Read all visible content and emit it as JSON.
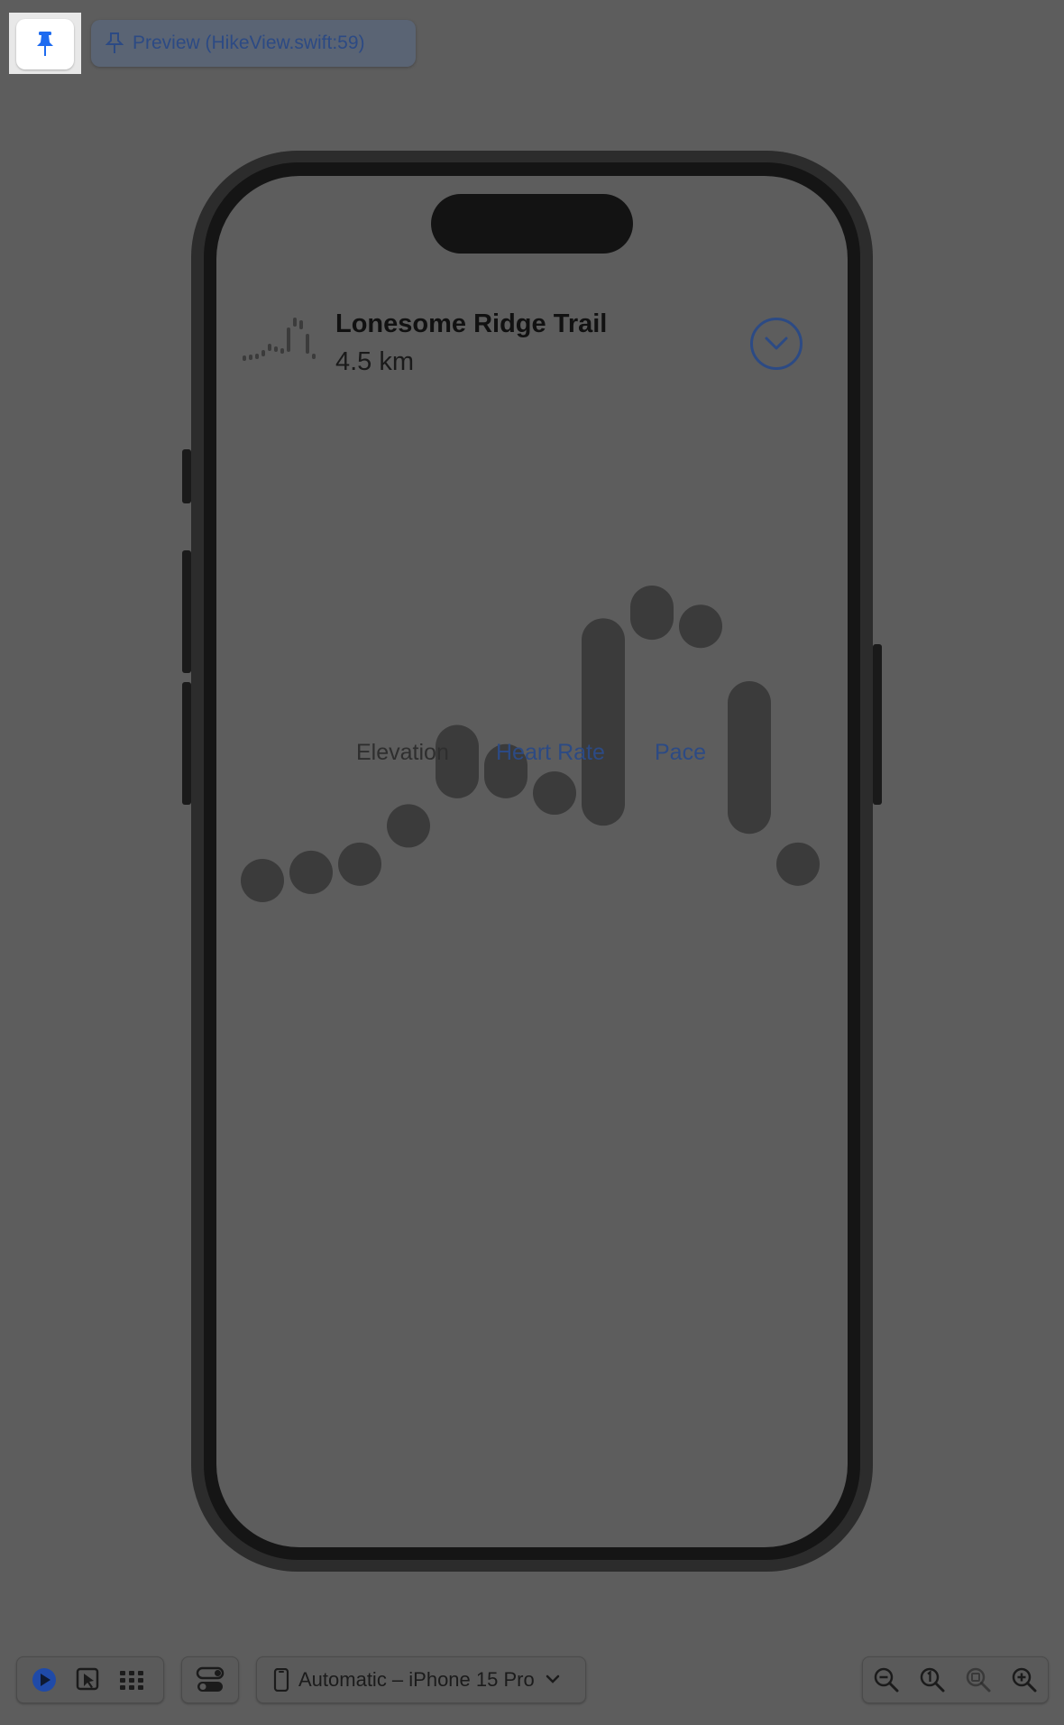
{
  "toolbar": {
    "pin_icon": "pin-icon",
    "preview_title": "Preview (HikeView.swift:59)"
  },
  "hike": {
    "name": "Lonesome Ridge Trail",
    "distance": "4.5 km"
  },
  "chart_data": {
    "type": "bar",
    "bars": [
      {
        "low": 0.0,
        "high": 0.0
      },
      {
        "low": 0.03,
        "high": 0.03
      },
      {
        "low": 0.06,
        "high": 0.06
      },
      {
        "low": 0.2,
        "high": 0.2
      },
      {
        "low": 0.38,
        "high": 0.49
      },
      {
        "low": 0.38,
        "high": 0.42
      },
      {
        "low": 0.32,
        "high": 0.32
      },
      {
        "low": 0.28,
        "high": 0.88
      },
      {
        "low": 0.96,
        "high": 1.0
      },
      {
        "low": 0.93,
        "high": 0.93
      },
      {
        "low": 0.25,
        "high": 0.65
      },
      {
        "low": 0.06,
        "high": 0.06
      }
    ]
  },
  "tabs": {
    "elevation": "Elevation",
    "heart_rate": "Heart Rate",
    "pace": "Pace"
  },
  "device": {
    "label": "Automatic – iPhone 15 Pro"
  },
  "colors": {
    "accent": "#2c4a84",
    "bar": "#3b3b3b"
  }
}
